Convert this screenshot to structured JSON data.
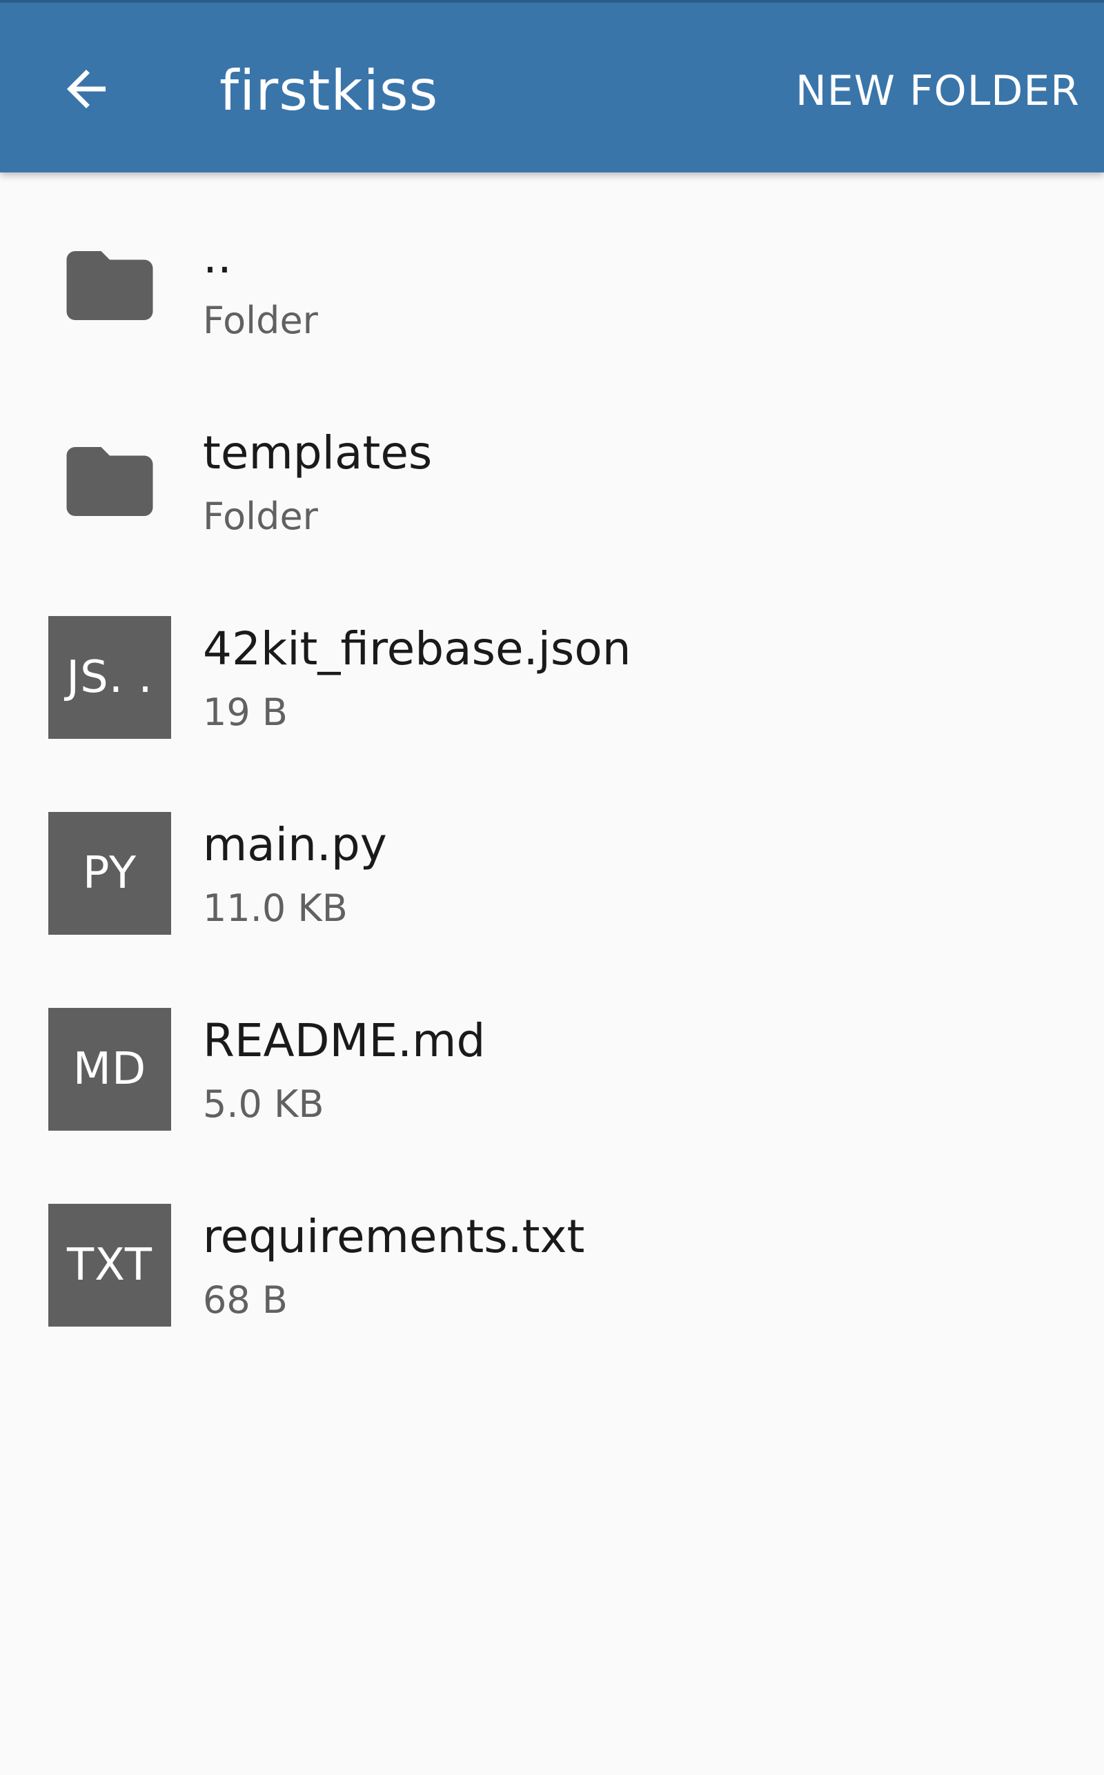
{
  "header": {
    "title": "firstkiss",
    "new_folder_label": "NEW FOLDER",
    "back_icon": "arrow-left-icon",
    "background_color": "#3a75aa"
  },
  "items": [
    {
      "name": "..",
      "meta": "Folder",
      "kind": "folder",
      "icon": "folder-icon"
    },
    {
      "name": "templates",
      "meta": "Folder",
      "kind": "folder",
      "icon": "folder-icon"
    },
    {
      "name": "42kit_firebase.json",
      "meta": "19 B",
      "kind": "file",
      "badge": "JS. ."
    },
    {
      "name": "main.py",
      "meta": "11.0 KB",
      "kind": "file",
      "badge": "PY"
    },
    {
      "name": "README.md",
      "meta": "5.0 KB",
      "kind": "file",
      "badge": "MD"
    },
    {
      "name": "requirements.txt",
      "meta": "68 B",
      "kind": "file",
      "badge": "TXT"
    }
  ],
  "colors": {
    "icon_gray": "#5f5f5f",
    "background": "#fafafa"
  }
}
